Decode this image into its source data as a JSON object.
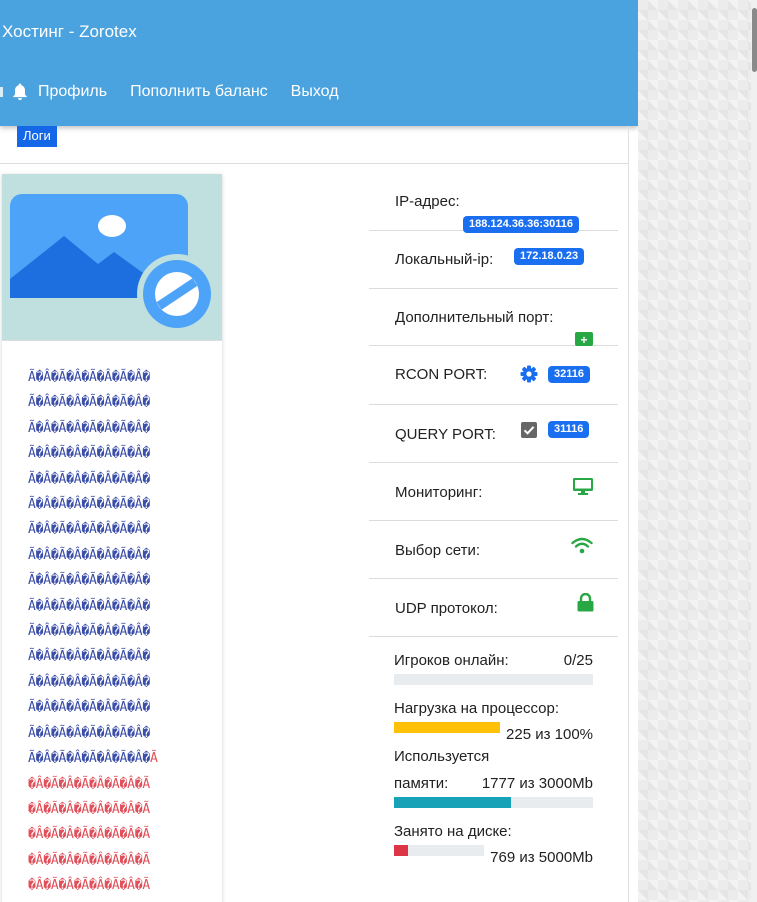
{
  "header": {
    "brand": "Хостинг - Zorotex",
    "nav": [
      {
        "label": "Профиль"
      },
      {
        "label": "Пополнить баланс"
      },
      {
        "label": "Выход"
      }
    ]
  },
  "logs_button": "Логи",
  "garbled_lines": [
    "Ã�Â�Ã�Â�Ã�Â�Ã�Â�",
    "Ã�Â�Ã�Â�Ã�Â�Ã�Â�",
    "Ã�Â�Ã�Â�Ã�Â�Ã�Â�",
    "Ã�Â�Ã�Â�Ã�Â�Ã�Â�",
    "Ã�Â�Ã�Â�Ã�Â�Ã�Â�",
    "Ã�Â�Ã�Â�Ã�Â�Ã�Â�",
    "Ã�Â�Ã�Â�Ã�Â�Ã�Â�",
    "Ã�Â�Ã�Â�Ã�Â�Ã�Â�",
    "Ã�Â�Ã�Â�Ã�Â�Ã�Â�",
    "Ã�Â�Ã�Â�Ã�Â�Ã�Â�",
    "Ã�Â�Ã�Â�Ã�Â�Ã�Â�",
    "Ã�Â�Ã�Â�Ã�Â�Ã�Â�",
    "Ã�Â�Ã�Â�Ã�Â�Ã�Â�",
    "Ã�Â�Ã�Â�Ã�Â�Ã�Â�",
    "Ã�Â�Ã�Â�Ã�Â�Ã�Â�",
    "Ã�Â�Ã�Â�Ã�Â�Ã�Â�Ã"
  ],
  "garbled_red_lines": [
    "�Â�Ã�Â�Ã�Â�Ã�Â�Ã",
    "�Â�Ã�Â�Ã�Â�Ã�Â�Ã",
    "�Â�Ã�Â�Ã�Â�Ã�Â�Ã",
    "�Â�Ã�Â�Ã�Â�Ã�Â�Ã",
    "�Â�Ã�Â�Ã�Â�Ã�Â�Ã"
  ],
  "server_info": {
    "ip_label": "IP-адрес:",
    "ip_value": "188.124.36.36:30116",
    "local_ip_label": "Локальный-ip:",
    "local_ip_value": "172.18.0.23",
    "extra_port_label": "Дополнительный порт:",
    "add_symbol": "+",
    "rcon_label": "RCON PORT:",
    "rcon_value": "32116",
    "query_label": "QUERY PORT:",
    "query_value": "31116",
    "monitoring_label": "Мониторинг:",
    "network_label": "Выбор сети:",
    "udp_label": "UDP протокол:"
  },
  "stats": {
    "players_label": "Игроков онлайн:",
    "players_value": "0/25",
    "players_fraction": 0.0,
    "cpu_label": "Нагрузка на процессор:",
    "cpu_value": "225 из 100%",
    "cpu_fraction": 0.54,
    "mem_label_1": "Используется",
    "mem_label_2": "памяти:",
    "mem_value": "1777 из 3000Mb",
    "mem_fraction": 0.59,
    "disk_label": "Занято на диске:",
    "disk_value": "769 из 5000Mb",
    "disk_fraction": 0.15
  },
  "colors": {
    "header": "#4aa3df",
    "badge": "#1a6ff0",
    "green": "#28a745",
    "cpu_bar": "#ffc107",
    "mem_bar": "#17a2b8",
    "disk_bar": "#dc3545"
  }
}
